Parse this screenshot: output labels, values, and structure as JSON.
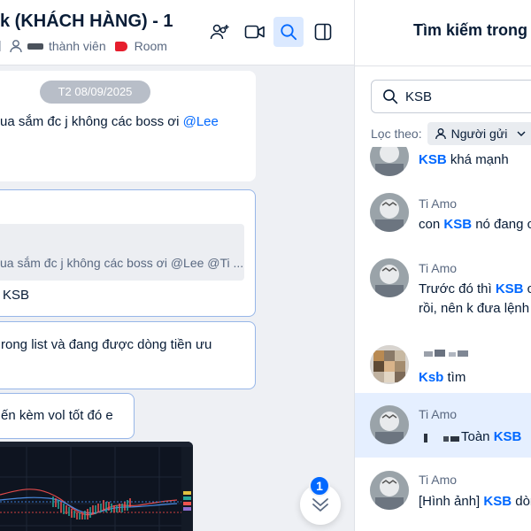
{
  "header": {
    "title": "k (KHÁCH HÀNG) - 1",
    "members_label": "thành viên",
    "room_label": "Room",
    "icons": [
      "add-member-icon",
      "video-call-icon",
      "search-icon",
      "sidebar-toggle-icon"
    ]
  },
  "chat": {
    "date_separator": "T2 08/09/2025",
    "msg1_text": "ua sắm đc j không các boss ơi ",
    "msg1_mention": "@Lee",
    "msg2_quote": "ua sắm đc j không các boss ơi @Lee @Ti ...",
    "msg2_text": "KSB",
    "msg3_line1": "rong list và đang được dòng tiền ưu",
    "msg4_text": "ến kèm vol tốt đó e",
    "unread_count": "1"
  },
  "search_panel": {
    "title": "Tìm kiếm trong",
    "query": "KSB",
    "filter_label": "Lọc theo:",
    "filter_chip": "Người gửi",
    "results": [
      {
        "name": "",
        "before": "",
        "keyword": "KSB",
        "after": " khá mạnh"
      },
      {
        "name": "Ti Amo",
        "before": "con ",
        "keyword": "KSB",
        "after": " nó đang c"
      },
      {
        "name": "Ti Amo",
        "before": "Trước đó thì ",
        "keyword": "KSB",
        "after": " co",
        "line2": "rồi, nên k đưa lệnh"
      },
      {
        "name": "",
        "before": "",
        "keyword": "Ksb",
        "after": " tìm"
      },
      {
        "name": "Ti Amo",
        "before": "Toàn ",
        "keyword": "KSB",
        "after": ""
      },
      {
        "name": "Ti Amo",
        "before": "[Hình ảnh] ",
        "keyword": "KSB",
        "after": " dòn"
      }
    ]
  }
}
